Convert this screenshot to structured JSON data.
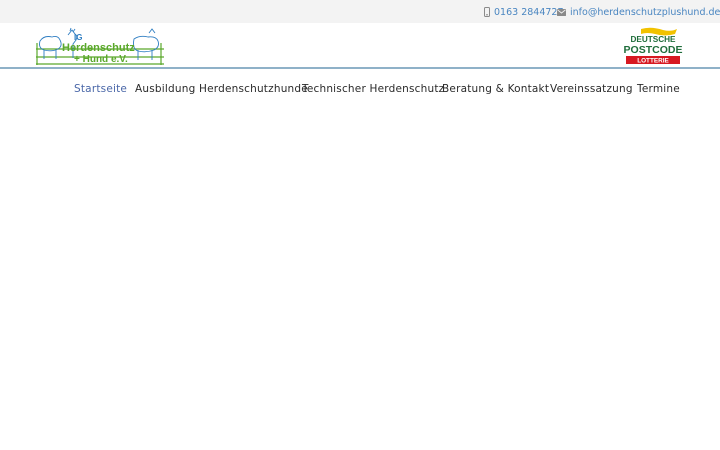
{
  "topbar": {
    "phone": "0163 2844727",
    "email": "info@herdenschutzplushund.de"
  },
  "logo": {
    "line1": "IG",
    "line2": "Herdenschutz",
    "line3": "+ Hund e.V."
  },
  "sponsor": {
    "line1": "DEUTSCHE",
    "line2": "POSTCODE",
    "line3": "LOTTERIE"
  },
  "nav": {
    "items": [
      {
        "label": "Startseite"
      },
      {
        "label": "Ausbildung Herdenschutzhunde"
      },
      {
        "label": "Technischer Herdenschutz"
      },
      {
        "label": "Beratung & Kontakt"
      },
      {
        "label": "Vereinssatzung"
      },
      {
        "label": "Termine"
      }
    ]
  },
  "colors": {
    "accent": "#4a67a8",
    "link": "#4a86c1",
    "logo_green": "#5aa82a",
    "logo_blue": "#2f7ec2"
  },
  "icons": {
    "phone": "mobile-phone-icon",
    "email": "envelope-icon"
  }
}
